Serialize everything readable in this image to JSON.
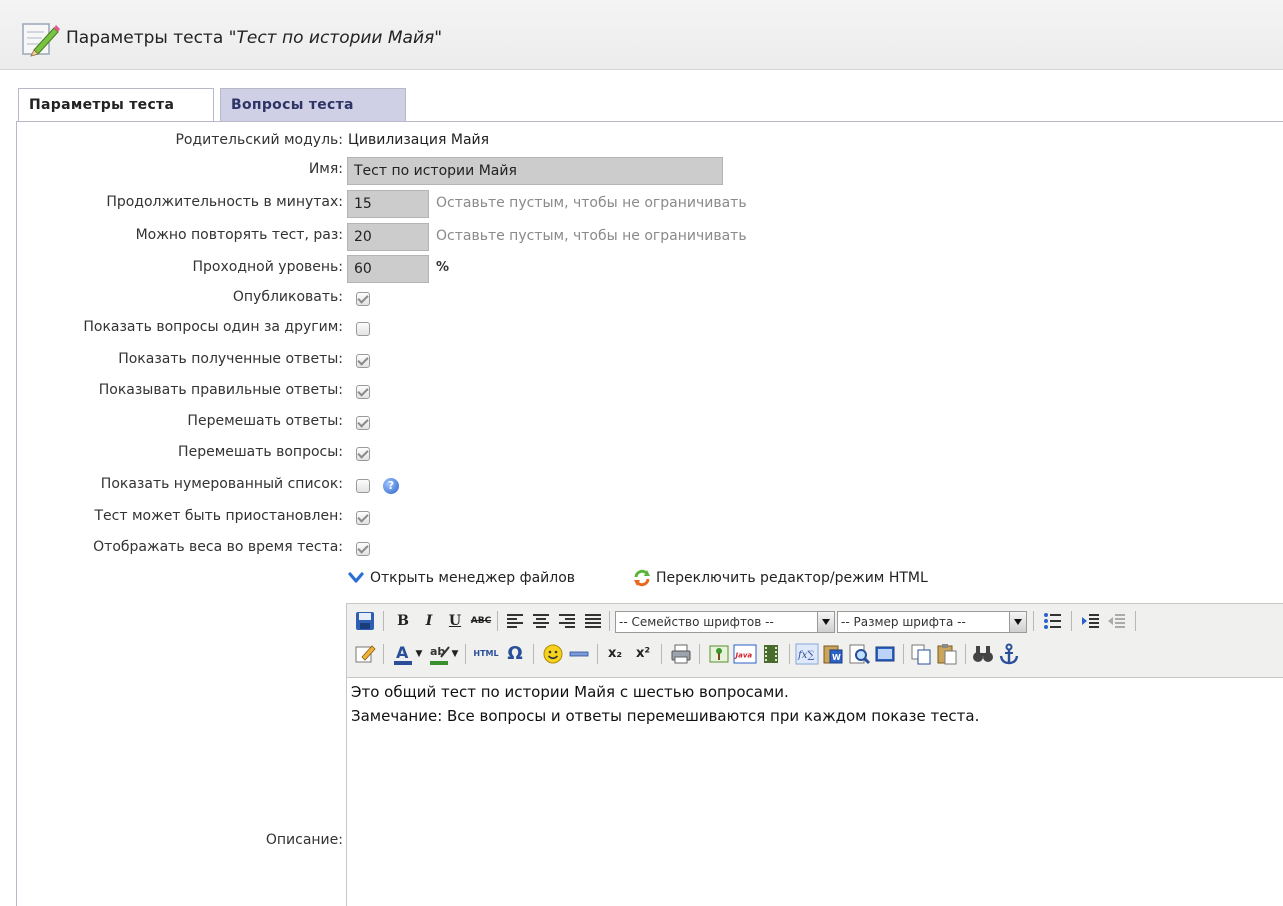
{
  "header": {
    "title_prefix": "Параметры теста ",
    "title_name": "\"Тест по истории Майя\""
  },
  "tabs": [
    {
      "label": "Параметры теста",
      "active": true
    },
    {
      "label": "Вопросы теста",
      "active": false
    }
  ],
  "form": {
    "parent_label": "Родительский модуль:",
    "parent_value": "Цивилизация Майя",
    "name_label": "Имя:",
    "name_value": "Тест по истории Майя",
    "duration_label": "Продолжительность в минутах:",
    "duration_value": "15",
    "duration_hint": "Оставьте пустым, чтобы не ограничивать",
    "repeat_label": "Можно повторять тест, раз:",
    "repeat_value": "20",
    "repeat_hint": "Оставьте пустым, чтобы не ограничивать",
    "pass_label": "Проходной уровень:",
    "pass_value": "60",
    "pass_unit": "%",
    "checkboxes": [
      {
        "label": "Опубликовать:",
        "checked": true
      },
      {
        "label": "Показать вопросы один за другим:",
        "checked": false
      },
      {
        "label": "Показать полученные ответы:",
        "checked": true
      },
      {
        "label": "Показывать правильные ответы:",
        "checked": true
      },
      {
        "label": "Перемешать ответы:",
        "checked": true
      },
      {
        "label": "Перемешать вопросы:",
        "checked": true
      },
      {
        "label": "Показать нумерованный список:",
        "checked": false
      },
      {
        "label": "Тест может быть приостановлен:",
        "checked": true
      },
      {
        "label": "Отображать веса во время теста:",
        "checked": true
      }
    ],
    "description_label": "Описание:"
  },
  "editor": {
    "open_files_link": "Открыть менеджер файлов",
    "switch_link": "Переключить редактор/режим HTML",
    "font_family_select": "-- Семейство шрифтов --",
    "font_size_select": "-- Размер шрифта --",
    "toolbar": {
      "bold": "B",
      "italic": "I",
      "underline": "U",
      "strike": "ABC",
      "html": "HTML",
      "omega": "Ω",
      "sub": "x₂",
      "sup": "x²"
    },
    "content_lines": [
      "Это общий тест по истории Майя с шестью вопросами.",
      "Замечание: Все вопросы и ответы перемешиваются при каждом показе теста."
    ]
  },
  "colors": {
    "tab_inactive_bg": "#cfd0e6",
    "input_bg": "#cccccc",
    "hint": "#8a8a8a"
  }
}
